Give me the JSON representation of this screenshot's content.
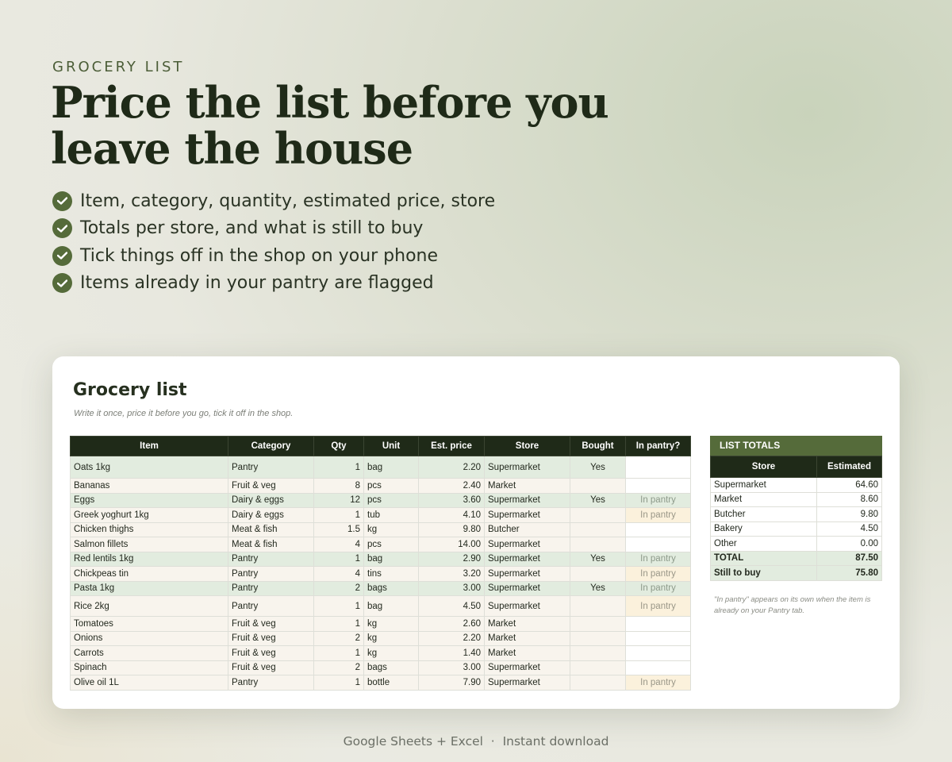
{
  "hero": {
    "eyebrow": "GROCERY LIST",
    "headline_line1": "Price the list before you",
    "headline_line2": "leave the house",
    "bullets": [
      "Item, category, quantity, estimated price, store",
      "Totals per store, and what is still to buy",
      "Tick things off in the shop on your phone",
      "Items already in your pantry are flagged"
    ]
  },
  "sheet": {
    "title": "Grocery list",
    "subtitle": "Write it once, price it before you go, tick it off in the shop.",
    "columns": [
      "Item",
      "Category",
      "Qty",
      "Unit",
      "Est. price",
      "Store",
      "Bought",
      "In pantry?"
    ],
    "rows": [
      {
        "item": "Oats 1kg",
        "category": "Pantry",
        "qty": "1",
        "unit": "bag",
        "price": "2.20",
        "store": "Supermarket",
        "bought": "Yes",
        "pantry": ""
      },
      {
        "item": "Bananas",
        "category": "Fruit & veg",
        "qty": "8",
        "unit": "pcs",
        "price": "2.40",
        "store": "Market",
        "bought": "",
        "pantry": ""
      },
      {
        "item": "Eggs",
        "category": "Dairy & eggs",
        "qty": "12",
        "unit": "pcs",
        "price": "3.60",
        "store": "Supermarket",
        "bought": "Yes",
        "pantry": "In pantry"
      },
      {
        "item": "Greek yoghurt 1kg",
        "category": "Dairy & eggs",
        "qty": "1",
        "unit": "tub",
        "price": "4.10",
        "store": "Supermarket",
        "bought": "",
        "pantry": "In pantry"
      },
      {
        "item": "Chicken thighs",
        "category": "Meat & fish",
        "qty": "1.5",
        "unit": "kg",
        "price": "9.80",
        "store": "Butcher",
        "bought": "",
        "pantry": ""
      },
      {
        "item": "Salmon fillets",
        "category": "Meat & fish",
        "qty": "4",
        "unit": "pcs",
        "price": "14.00",
        "store": "Supermarket",
        "bought": "",
        "pantry": ""
      },
      {
        "item": "Red lentils 1kg",
        "category": "Pantry",
        "qty": "1",
        "unit": "bag",
        "price": "2.90",
        "store": "Supermarket",
        "bought": "Yes",
        "pantry": "In pantry"
      },
      {
        "item": "Chickpeas tin",
        "category": "Pantry",
        "qty": "4",
        "unit": "tins",
        "price": "3.20",
        "store": "Supermarket",
        "bought": "",
        "pantry": "In pantry"
      },
      {
        "item": "Pasta 1kg",
        "category": "Pantry",
        "qty": "2",
        "unit": "bags",
        "price": "3.00",
        "store": "Supermarket",
        "bought": "Yes",
        "pantry": "In pantry"
      },
      {
        "item": "Rice 2kg",
        "category": "Pantry",
        "qty": "1",
        "unit": "bag",
        "price": "4.50",
        "store": "Supermarket",
        "bought": "",
        "pantry": "In pantry"
      },
      {
        "item": "Tomatoes",
        "category": "Fruit & veg",
        "qty": "1",
        "unit": "kg",
        "price": "2.60",
        "store": "Market",
        "bought": "",
        "pantry": ""
      },
      {
        "item": "Onions",
        "category": "Fruit & veg",
        "qty": "2",
        "unit": "kg",
        "price": "2.20",
        "store": "Market",
        "bought": "",
        "pantry": ""
      },
      {
        "item": "Carrots",
        "category": "Fruit & veg",
        "qty": "1",
        "unit": "kg",
        "price": "1.40",
        "store": "Market",
        "bought": "",
        "pantry": ""
      },
      {
        "item": "Spinach",
        "category": "Fruit & veg",
        "qty": "2",
        "unit": "bags",
        "price": "3.00",
        "store": "Supermarket",
        "bought": "",
        "pantry": ""
      },
      {
        "item": "Olive oil 1L",
        "category": "Pantry",
        "qty": "1",
        "unit": "bottle",
        "price": "7.90",
        "store": "Supermarket",
        "bought": "",
        "pantry": "In pantry"
      }
    ]
  },
  "totals": {
    "title": "LIST TOTALS",
    "col_store": "Store",
    "col_estimated": "Estimated",
    "rows": [
      {
        "store": "Supermarket",
        "value": "64.60"
      },
      {
        "store": "Market",
        "value": "8.60"
      },
      {
        "store": "Butcher",
        "value": "9.80"
      },
      {
        "store": "Bakery",
        "value": "4.50"
      },
      {
        "store": "Other",
        "value": "0.00"
      }
    ],
    "total_label": "TOTAL",
    "total_value": "87.50",
    "still_label": "Still to buy",
    "still_value": "75.80",
    "note": "\"In pantry\" appears on its own when the item is already on your Pantry tab."
  },
  "footer": "Google Sheets + Excel  ·  Instant download",
  "colors": {
    "accent": "#556b3a",
    "dark": "#1f2a18",
    "bought_row": "#e2ecdf",
    "todo_row": "#f8f4ed",
    "pantry_flag": "#fbf1dc"
  }
}
